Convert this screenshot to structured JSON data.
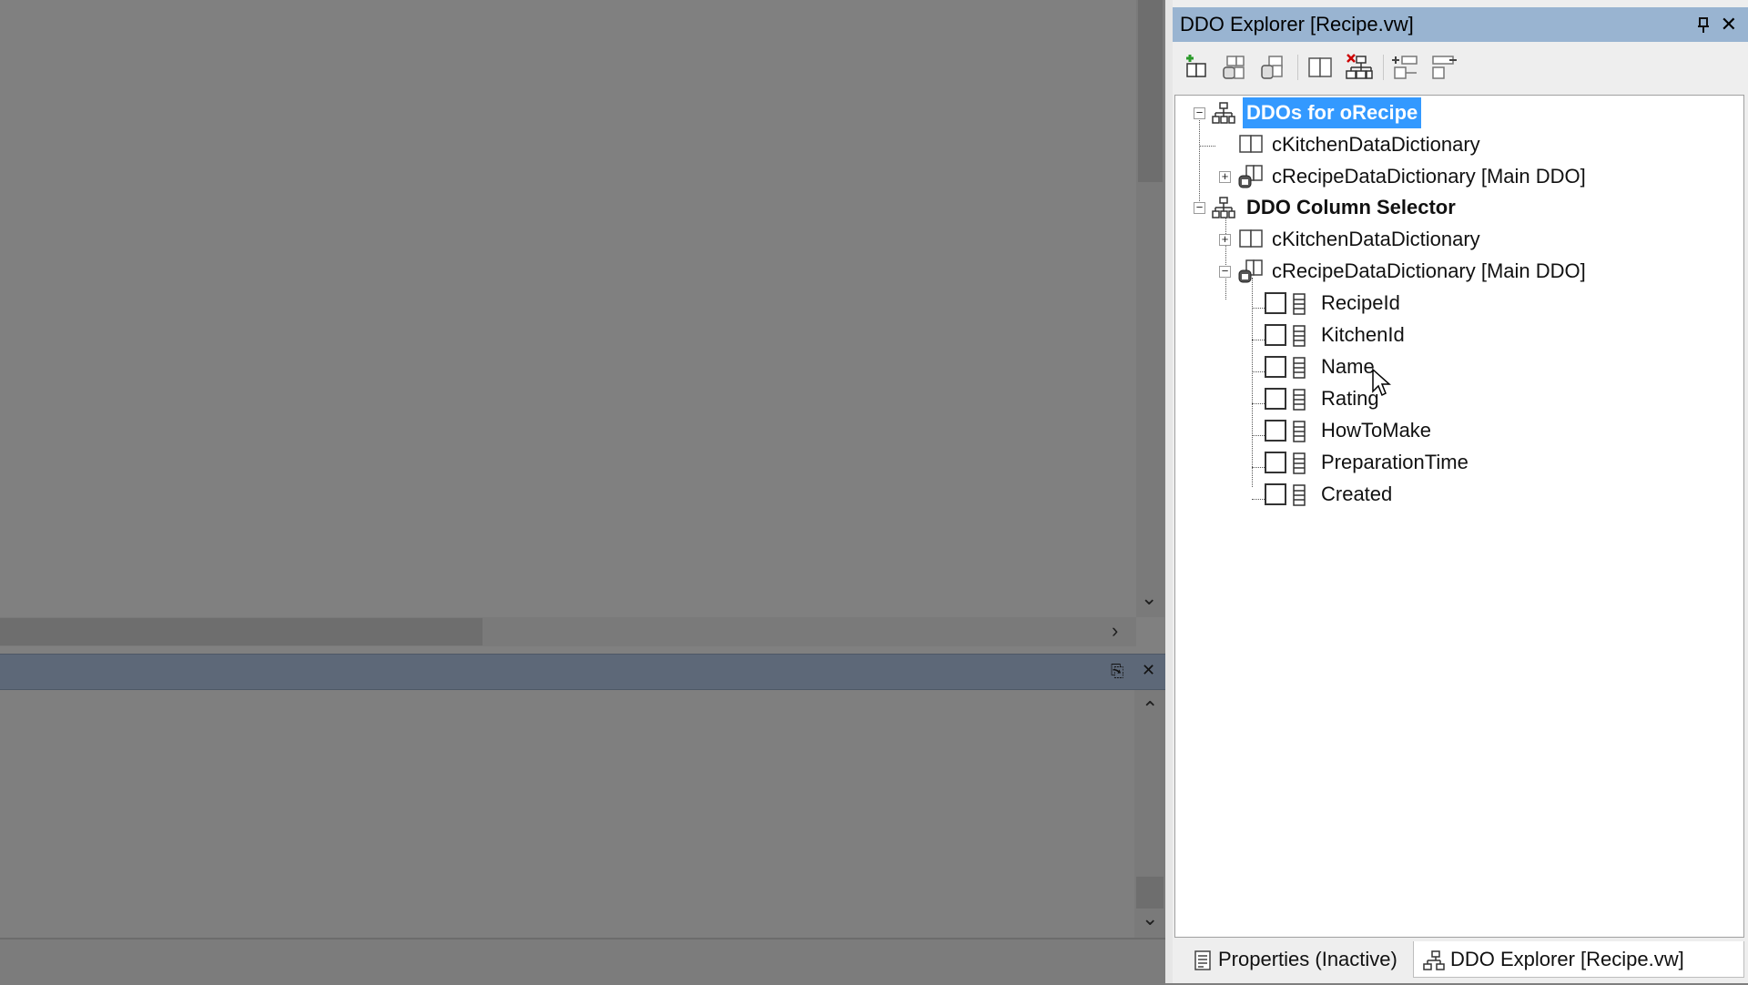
{
  "explorer": {
    "title": "DDO Explorer [Recipe.vw]",
    "pin_glyph": "⌂",
    "close_glyph": "✕",
    "toolbar_icons": [
      "add-ddo-icon",
      "edit-ddo-icon",
      "ddo-properties-icon",
      "dictionary-icon",
      "delete-structure-icon",
      "expand-all-icon",
      "collapse-all-icon"
    ]
  },
  "tree": {
    "root1": {
      "label": "DDOs for oRecipe",
      "expander": "−"
    },
    "root1_children": [
      {
        "label": "cKitchenDataDictionary"
      },
      {
        "label": "cRecipeDataDictionary [Main DDO]",
        "expander": "+"
      }
    ],
    "root2": {
      "label": "DDO Column Selector",
      "expander": "−"
    },
    "root2_children": [
      {
        "label": "cKitchenDataDictionary",
        "expander": "+"
      },
      {
        "label": "cRecipeDataDictionary [Main DDO]",
        "expander": "−"
      }
    ],
    "columns": [
      "RecipeId",
      "KitchenId",
      "Name",
      "Rating",
      "HowToMake",
      "PreparationTime",
      "Created"
    ]
  },
  "tabs": {
    "properties": "Properties (Inactive)",
    "ddo_explorer": "DDO Explorer [Recipe.vw]"
  },
  "colors": {
    "title_bar": "#99b4d1",
    "selection": "#3399ff",
    "bottom_header": "#5d6878"
  }
}
